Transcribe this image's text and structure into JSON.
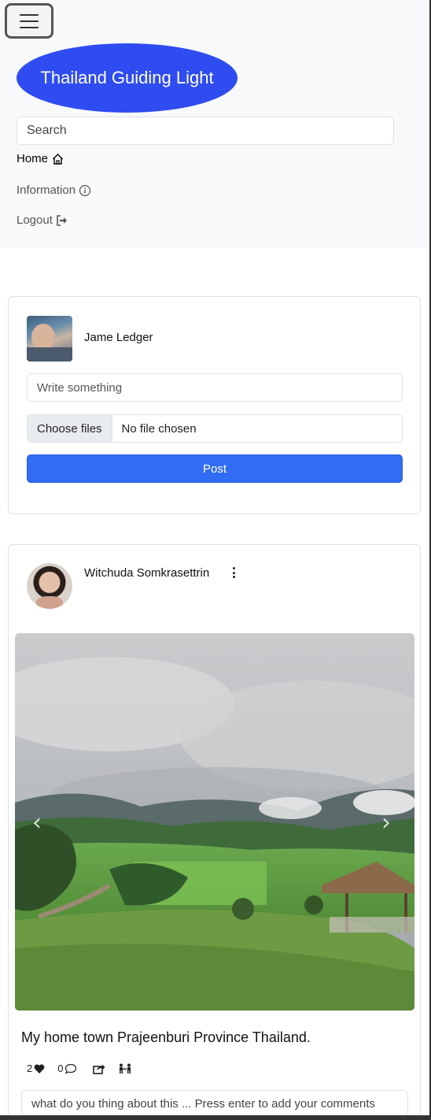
{
  "nav": {
    "brand": "Thailand Guiding Light",
    "search_placeholder": "Search",
    "links": [
      {
        "label": "Home",
        "icon": "home-icon",
        "active": true
      },
      {
        "label": "Information",
        "icon": "info-circle-icon",
        "active": false
      },
      {
        "label": "Logout",
        "icon": "logout-icon",
        "active": false
      }
    ]
  },
  "composer": {
    "user_name": "Jame Ledger",
    "text_placeholder": "Write something",
    "choose_files_label": "Choose files",
    "no_file_label": "No file chosen",
    "post_label": "Post"
  },
  "post": {
    "author": "Witchuda Somkrasettrin",
    "title": "My home town Prajeenburi Province Thailand.",
    "likes": "2",
    "comments": "0",
    "comment_placeholder": "what do you thing about this ... Press enter to add your comments"
  },
  "colors": {
    "brand_bg": "#2f4cf0",
    "primary_button": "#316cf4",
    "navbar_bg": "#f8f9fa"
  }
}
